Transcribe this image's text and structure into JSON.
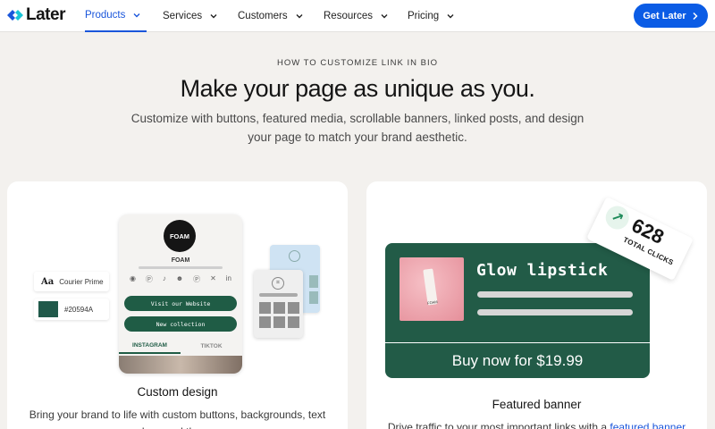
{
  "nav": {
    "logo": "Later",
    "items": [
      {
        "label": "Products"
      },
      {
        "label": "Services"
      },
      {
        "label": "Customers"
      },
      {
        "label": "Resources"
      },
      {
        "label": "Pricing"
      }
    ],
    "cta": "Get Later"
  },
  "hero": {
    "eyebrow": "HOW TO CUSTOMIZE LINK IN BIO",
    "headline": "Make your page as unique as you.",
    "subhead": "Customize with buttons, featured media, scrollable banners, linked posts, and design your page to match your brand aesthetic."
  },
  "card_left": {
    "title": "Custom design",
    "desc": "Bring your brand to life with custom buttons, backgrounds, text colors, and themes.",
    "font_sample": "Aa",
    "font_name": "Courier Prime",
    "color_hex": "#20594A",
    "profile_initials": "FOAM",
    "profile_name": "FOAM",
    "btn1": "Visit our Website",
    "btn2": "New collection",
    "tab1": "INSTAGRAM",
    "tab2": "TIKTOK",
    "socials": [
      "instagram-icon",
      "pinterest-icon",
      "tiktok-icon",
      "snapchat-icon",
      "pinterest-icon",
      "x-icon",
      "linkedin-icon"
    ]
  },
  "card_right": {
    "title": "Featured banner",
    "desc_prefix": "Drive traffic to your most important links with a ",
    "desc_link": "featured banner",
    "banner_title": "Glow lipstick",
    "banner_cta": "Buy now for $19.99",
    "clicks_count": "628",
    "clicks_label": "TOTAL CLICKS",
    "lipstick_brand": "FOAM"
  },
  "colors": {
    "accent": "#0B5CE5",
    "brand_green": "#225B47",
    "background": "#F3F1EE"
  }
}
